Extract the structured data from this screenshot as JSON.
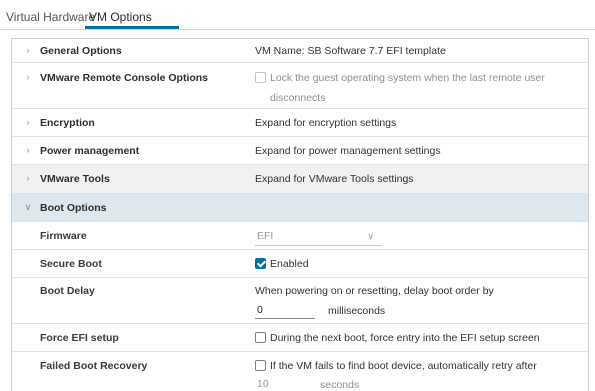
{
  "tabs": [
    {
      "label": "Virtual Hardware"
    },
    {
      "label": "VM Options"
    }
  ],
  "general_options": {
    "label": "General Options",
    "value": "VM Name: SB Software 7.7 EFI template"
  },
  "remote_console": {
    "label": "VMware Remote Console Options",
    "checkbox_line1": "Lock the guest operating system when the last remote user",
    "checkbox_line2": "disconnects"
  },
  "encryption": {
    "label": "Encryption",
    "value": "Expand for encryption settings"
  },
  "power": {
    "label": "Power management",
    "value": "Expand for power management settings"
  },
  "tools": {
    "label": "VMware Tools",
    "value": "Expand for VMware Tools settings"
  },
  "boot": {
    "label": "Boot Options",
    "firmware": {
      "label": "Firmware",
      "selected": "EFI"
    },
    "secure_boot": {
      "label": "Secure Boot",
      "checked": true,
      "text": "Enabled"
    },
    "boot_delay": {
      "label": "Boot Delay",
      "description": "When powering on or resetting, delay boot order by",
      "value": "0",
      "unit": "milliseconds"
    },
    "force_efi": {
      "label": "Force EFI setup",
      "checked": false,
      "text": "During the next boot, force entry into the EFI setup screen"
    },
    "failed_recovery": {
      "label": "Failed Boot Recovery",
      "checked": false,
      "text": "If the VM fails to find boot device, automatically retry after",
      "value": "10",
      "unit": "seconds"
    }
  },
  "colors": {
    "accent": "#0072a3",
    "selected_row": "#dde7ef",
    "shaded_row": "#f1f1f1"
  }
}
